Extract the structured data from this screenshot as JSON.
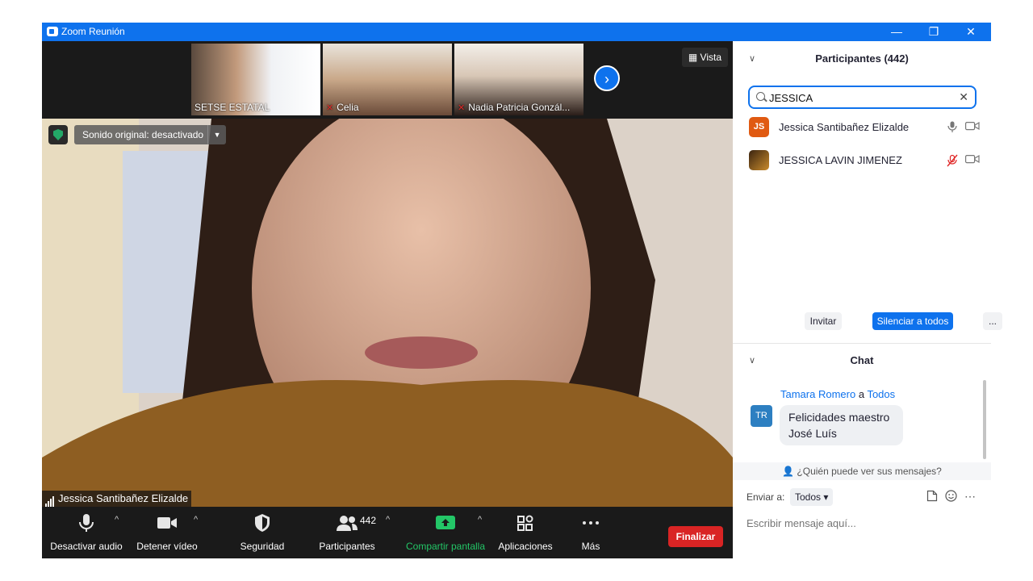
{
  "window": {
    "title": "Zoom Reunión",
    "minimize": "—",
    "restore": "❐",
    "close": "✕"
  },
  "thumbnails": [
    {
      "name": "SETSE ESTATAL",
      "muted": false
    },
    {
      "name": "Celia",
      "muted": true
    },
    {
      "name": "Nadia Patricia Gonzál...",
      "muted": true
    }
  ],
  "view_button": "Vista",
  "sound_original": "Sonido original: desactivado",
  "active_speaker": "Jessica Santibañez Elizalde",
  "toolbar": {
    "mute": "Desactivar audio",
    "video": "Detener vídeo",
    "security": "Seguridad",
    "participants": "Participantes",
    "participants_count": "442",
    "share": "Compartir pantalla",
    "apps": "Aplicaciones",
    "more": "Más",
    "end": "Finalizar"
  },
  "participants_panel": {
    "title": "Participantes (442)",
    "search_value": "JESSICA",
    "results": [
      {
        "initials": "JS",
        "name": "Jessica Santibañez Elizalde",
        "avatar_color": "#e05a12",
        "mic": "on"
      },
      {
        "initials": "",
        "name": "JESSICA LAVIN JIMENEZ",
        "avatar_color": "#7a4a1a",
        "mic": "muted"
      }
    ],
    "invite": "Invitar",
    "mute_all": "Silenciar a todos",
    "more": "..."
  },
  "chat": {
    "title": "Chat",
    "messages": [
      {
        "initials": "TR",
        "sender": "Tamara Romero",
        "connector": "a",
        "recipient": "Todos",
        "text": "Felicidades maestro José Luís"
      }
    ],
    "who_can_see": "¿Quién puede ver sus mensajes?",
    "send_to_label": "Enviar a:",
    "send_to_value": "Todos",
    "placeholder": "Escribir mensaje aquí..."
  },
  "colors": {
    "accent": "#0e72ed",
    "end": "#d92424",
    "share": "#23c667",
    "muted": "#e02828"
  }
}
